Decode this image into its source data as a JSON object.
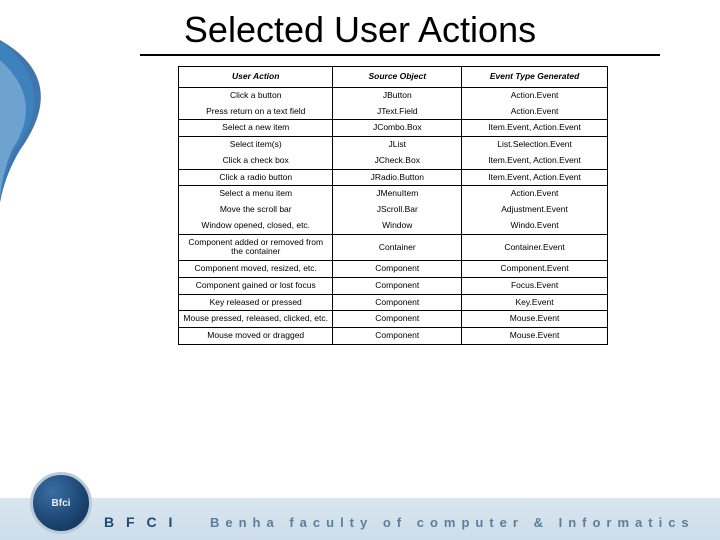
{
  "title": "Selected User Actions",
  "headers": [
    "User Action",
    "Source Object",
    "Event Type Generated"
  ],
  "groups": [
    [
      {
        "action": "Click a button",
        "source": "JButton",
        "event": "Action.Event"
      },
      {
        "action": "Press return on a text field",
        "source": "JText.Field",
        "event": "Action.Event"
      }
    ],
    [
      {
        "action": "Select a new item",
        "source": "JCombo.Box",
        "event": "Item.Event, Action.Event"
      }
    ],
    [
      {
        "action": "Select item(s)",
        "source": "JList",
        "event": "List.Selection.Event"
      },
      {
        "action": "Click a check box",
        "source": "JCheck.Box",
        "event": "Item.Event, Action.Event"
      }
    ],
    [
      {
        "action": "Click a radio button",
        "source": "JRadio.Button",
        "event": "Item.Event, Action.Event"
      }
    ],
    [
      {
        "action": "Select a menu item",
        "source": "JMenuItem",
        "event": "Action.Event"
      },
      {
        "action": "Move the scroll bar",
        "source": "JScroll.Bar",
        "event": "Adjustment.Event"
      },
      {
        "action": "Window opened, closed, etc.",
        "source": "Window",
        "event": "Windo.Event"
      }
    ],
    [
      {
        "action": "Component added or removed from the container",
        "source": "Container",
        "event": "Container.Event"
      }
    ],
    [
      {
        "action": "Component moved, resized, etc.",
        "source": "Component",
        "event": "Component.Event"
      }
    ],
    [
      {
        "action": "Component gained or lost focus",
        "source": "Component",
        "event": "Focus.Event"
      }
    ],
    [
      {
        "action": "Key released or pressed",
        "source": "Component",
        "event": "Key.Event"
      }
    ],
    [
      {
        "action": "Mouse pressed, released, clicked, etc.",
        "source": "Component",
        "event": "Mouse.Event"
      }
    ],
    [
      {
        "action": "Mouse moved or dragged",
        "source": "Component",
        "event": "Mouse.Event"
      }
    ]
  ],
  "footer": {
    "logo_text": "Bfci",
    "abbrev": "B F C I",
    "faculty": "Benha  faculty  of  computer  &  Informatics"
  }
}
